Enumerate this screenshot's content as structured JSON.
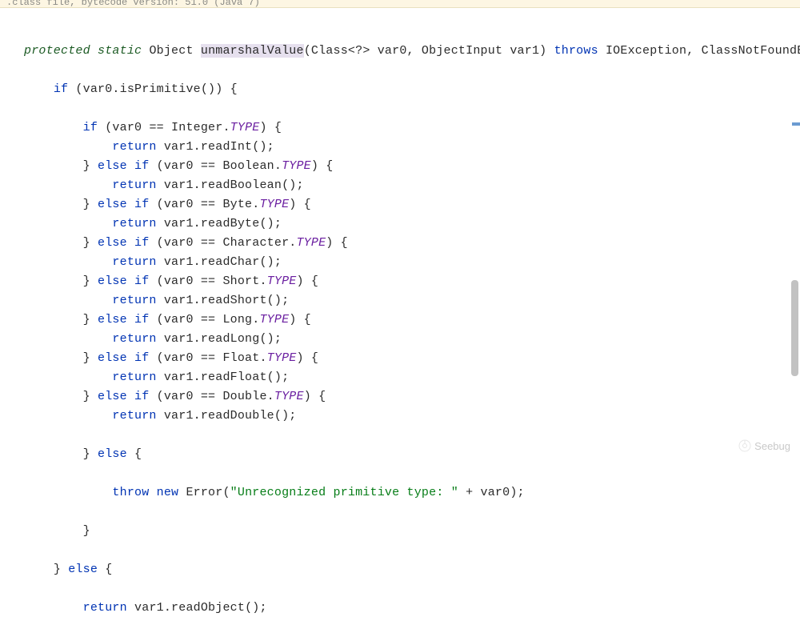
{
  "banner": ".class file, bytecode version: 51.0 (Java 7)",
  "watermark": "Seebug",
  "code": {
    "sig": {
      "modifier1": "protected",
      "modifier2": "static",
      "ret": "Object",
      "name": "unmarshalValue",
      "params": "(Class<?> var0, ObjectInput var1)",
      "throws_kw": "throws",
      "throws_list": "IOException, ClassNotFoundEx"
    },
    "if_cond": "if",
    "outer_cond": "(var0.isPrimitive()) {",
    "branches": [
      {
        "cond": "if (var0 == Integer.",
        "field": "TYPE",
        "after": ") {",
        "ret": "return",
        "body": " var1.readInt();"
      },
      {
        "cond": "} else if (var0 == Boolean.",
        "field": "TYPE",
        "after": ") {",
        "ret": "return",
        "body": " var1.readBoolean();"
      },
      {
        "cond": "} else if (var0 == Byte.",
        "field": "TYPE",
        "after": ") {",
        "ret": "return",
        "body": " var1.readByte();"
      },
      {
        "cond": "} else if (var0 == Character.",
        "field": "TYPE",
        "after": ") {",
        "ret": "return",
        "body": " var1.readChar();"
      },
      {
        "cond": "} else if (var0 == Short.",
        "field": "TYPE",
        "after": ") {",
        "ret": "return",
        "body": " var1.readShort();"
      },
      {
        "cond": "} else if (var0 == Long.",
        "field": "TYPE",
        "after": ") {",
        "ret": "return",
        "body": " var1.readLong();"
      },
      {
        "cond": "} else if (var0 == Float.",
        "field": "TYPE",
        "after": ") {",
        "ret": "return",
        "body": " var1.readFloat();"
      },
      {
        "cond": "} else if (var0 == Double.",
        "field": "TYPE",
        "after": ") {",
        "ret": "return",
        "body": " var1.readDouble();"
      }
    ],
    "else_inner_open": "} else {",
    "throw_kw": "throw new",
    "throw_cls": " Error(",
    "throw_str": "\"Unrecognized primitive type: \"",
    "throw_tail": " + var0);",
    "close_inner": "}",
    "else_outer_open": "} else {",
    "ret_outer_kw": "return",
    "ret_outer_body": " var1.readObject();"
  }
}
